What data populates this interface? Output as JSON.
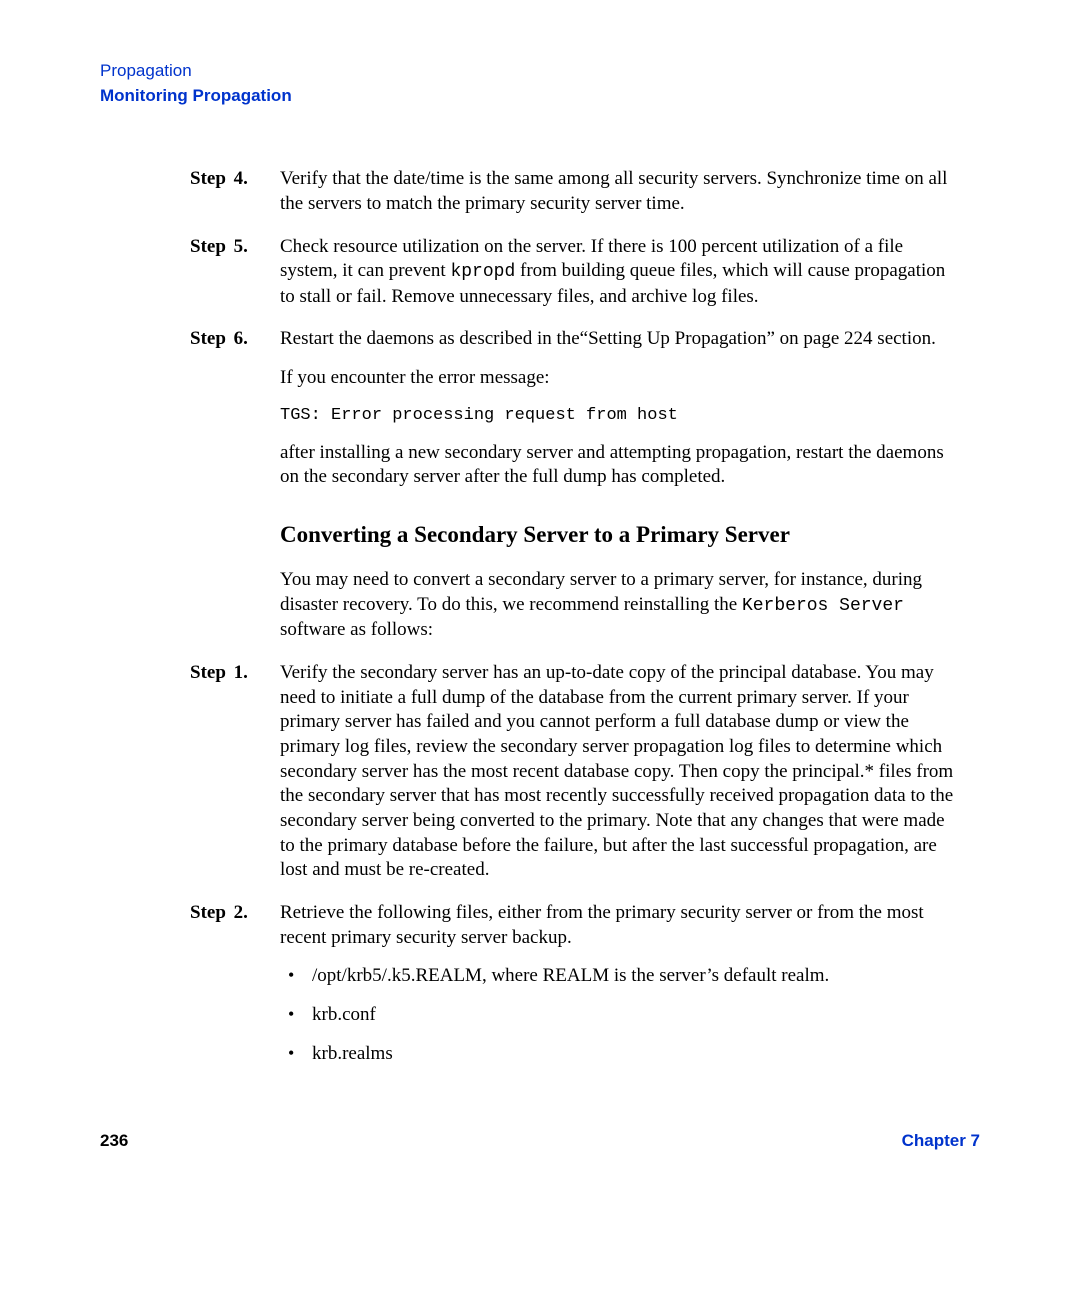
{
  "header": {
    "line1": "Propagation",
    "line2": "Monitoring Propagation"
  },
  "steps_a": [
    {
      "label": "Step",
      "num": "4.",
      "paras": [
        {
          "text": "Verify that the date/time is the same among all security servers. Synchronize time on all the servers to match the primary security server time."
        }
      ]
    },
    {
      "label": "Step",
      "num": "5.",
      "paras": [
        {
          "segments": [
            {
              "text": "Check resource utilization on the server. If there is 100 percent utilization of a file system, it can prevent "
            },
            {
              "text": "kpropd",
              "mono": true
            },
            {
              "text": " from building queue files, which will cause propagation to stall or fail. Remove unnecessary files, and archive log files."
            }
          ]
        }
      ]
    },
    {
      "label": "Step",
      "num": "6.",
      "paras": [
        {
          "text": "Restart the daemons as described in the“Setting Up Propagation” on page 224 section."
        },
        {
          "text": "If you encounter the error message:"
        },
        {
          "text": "TGS: Error processing request from host",
          "code": true
        },
        {
          "text": "after installing a new secondary server and attempting propagation, restart the daemons on the secondary server after the full dump has completed."
        }
      ]
    }
  ],
  "section_heading": "Converting a Secondary Server to a Primary Server",
  "section_intro": {
    "segments": [
      {
        "text": "You may need to convert a secondary server to a primary server, for instance, during disaster recovery. To do this, we recommend reinstalling the "
      },
      {
        "text": "Kerberos Server",
        "mono": true
      },
      {
        "text": " software as follows:"
      }
    ]
  },
  "steps_b": [
    {
      "label": "Step",
      "num": "1.",
      "paras": [
        {
          "text": "Verify the secondary server has an up-to-date copy of the principal database. You may need to initiate a full dump of the database from the current primary server. If your primary server has failed and you cannot perform a full database dump or view the primary log files, review the secondary server propagation log files to determine which secondary server has the most recent database copy. Then copy the principal.* files from the secondary server that has most recently successfully received propagation data to the secondary server being converted to the primary. Note that any changes that were made to the primary database before the failure, but after the last successful propagation, are lost and must be re-created."
        }
      ]
    },
    {
      "label": "Step",
      "num": "2.",
      "paras": [
        {
          "text": "Retrieve the following files, either from the primary security server or from the most recent primary security server backup."
        }
      ],
      "bullets": [
        "/opt/krb5/.k5.REALM, where REALM is the server’s default realm.",
        "krb.conf",
        "krb.realms"
      ]
    }
  ],
  "footer": {
    "page": "236",
    "chapter": "Chapter 7"
  }
}
